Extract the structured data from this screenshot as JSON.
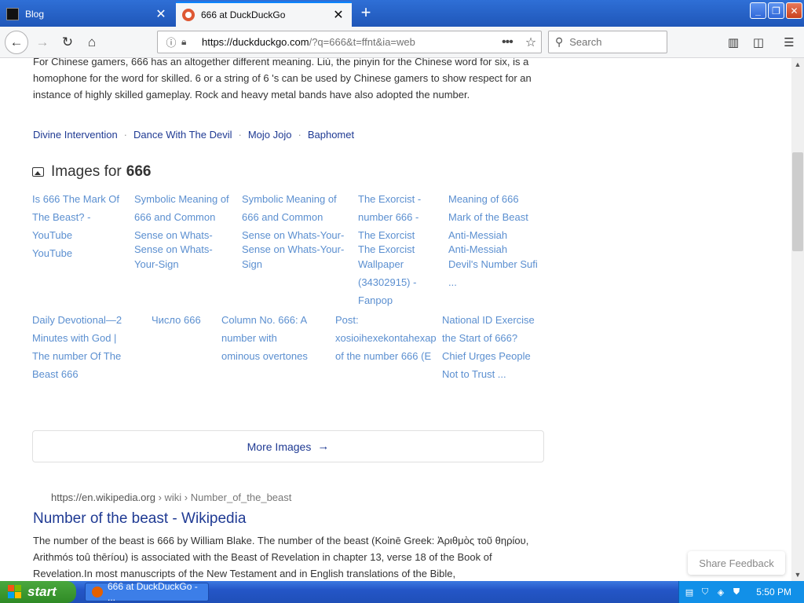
{
  "tabs": [
    {
      "label": "Blog"
    },
    {
      "label": "666 at DuckDuckGo"
    }
  ],
  "navbar": {
    "url_host": "https://duckduckgo.com",
    "url_rest": "/?q=666&t=ffnt&ia=web",
    "search_placeholder": "Search"
  },
  "page": {
    "intro_text": "For Chinese gamers, 666 has an altogether different meaning. Liù, the pinyin for the Chinese word for six, is a homophone for the word for skilled. 6 or a string of 6 's can be used by Chinese gamers to show respect for an instance of highly skilled gameplay. Rock and heavy metal bands have also adopted the number.",
    "related_links": [
      "Divine Intervention",
      "Dance With The Devil",
      "Mojo Jojo",
      "Baphomet"
    ],
    "images_heading_prefix": "Images for",
    "images_heading_query": "666",
    "image_tiles": [
      {
        "lines": [
          "Is 666 The Mark Of",
          "The Beast? -",
          "YouTube",
          "YouTube"
        ]
      },
      {
        "lines": [
          "Symbolic Meaning of",
          "666 and Common",
          "Sense on Whats-",
          "Sense on Whats-",
          "Your-Sign"
        ]
      },
      {
        "lines": [
          "Symbolic Meaning of",
          "666 and Common",
          "Sense on Whats-Your-",
          "Sense on Whats-Your-",
          "Sign"
        ]
      },
      {
        "lines": [
          "The Exorcist -",
          "number 666 -",
          "The Exorcist",
          "The Exorcist",
          "Wallpaper",
          "(34302915) -",
          "Fanpop"
        ]
      },
      {
        "lines": [
          "Meaning of 666",
          "Mark of the Beast",
          "Anti-Messiah",
          "Anti-Messiah",
          "Devil's Number Sufi",
          "..."
        ]
      },
      {
        "lines": [
          "Daily Devotional—2",
          "Minutes with God |",
          "The number Of The",
          "Beast 666"
        ]
      },
      {
        "lines": [
          "Число 666"
        ]
      },
      {
        "lines": [
          "Column No. 666: A",
          "number with",
          "ominous overtones"
        ]
      },
      {
        "lines": [
          "Post:",
          "xosioihexekontahexap",
          "of the number 666 (E"
        ]
      },
      {
        "lines": [
          "National ID Exercise",
          "the Start of 666?",
          "Chief Urges People",
          "Not to Trust ..."
        ]
      }
    ],
    "more_images_label": "More Images",
    "result": {
      "url_host": "https://en.wikipedia.org",
      "url_path": " › wiki › Number_of_the_beast",
      "title": "Number of the beast - Wikipedia",
      "snippet": "The number of the beast is 666 by William Blake. The number of the beast (Koinē Greek: Ἀριθμὸς τοῦ θηρίου, Arithmós toû thēríou) is associated with the Beast of Revelation in chapter 13, verse 18 of the Book of Revelation.In most manuscripts of the New Testament and in English translations of the Bible,"
    },
    "share_feedback_label": "Share Feedback"
  },
  "taskbar": {
    "start_label": "start",
    "task_label": "666 at DuckDuckGo - ...",
    "clock": "5:50 PM"
  }
}
